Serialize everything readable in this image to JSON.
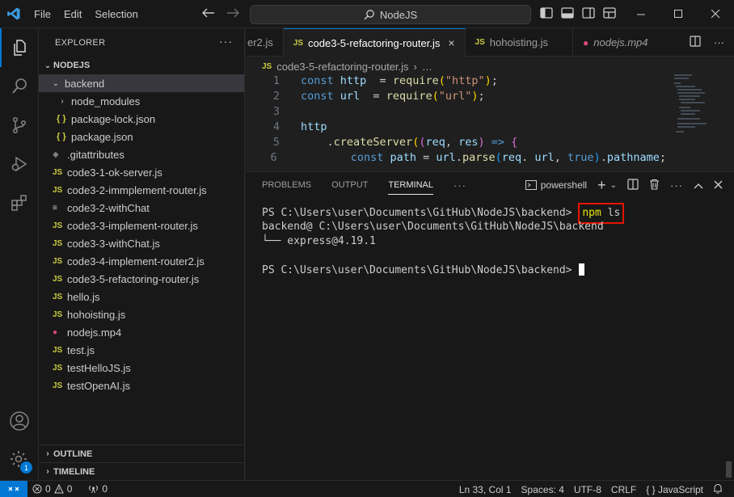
{
  "titlebar": {
    "menu": [
      "File",
      "Edit",
      "Selection"
    ],
    "search_text": "NodeJS"
  },
  "activity_bar": {
    "icons": [
      "explorer-icon",
      "search-icon",
      "source-control-icon",
      "run-debug-icon",
      "extensions-icon",
      "account-icon",
      "manage-icon"
    ],
    "manage_badge": "1",
    "accent": "#0078d4"
  },
  "explorer": {
    "title": "EXPLORER",
    "root": "NODEJS",
    "items": [
      {
        "label": "backend",
        "type": "folder-open",
        "depth": 1
      },
      {
        "label": "node_modules",
        "type": "folder",
        "depth": 2
      },
      {
        "label": "package-lock.json",
        "type": "json",
        "depth": 2
      },
      {
        "label": "package.json",
        "type": "json",
        "depth": 2
      },
      {
        "label": ".gitattributes",
        "type": "git",
        "depth": 1
      },
      {
        "label": "code3-1-ok-server.js",
        "type": "js",
        "depth": 1
      },
      {
        "label": "code3-2-immplement-router.js",
        "type": "js",
        "depth": 1
      },
      {
        "label": "code3-2-withChat",
        "type": "md",
        "depth": 1
      },
      {
        "label": "code3-3-implement-router.js",
        "type": "js",
        "depth": 1
      },
      {
        "label": "code3-3-withChat.js",
        "type": "js",
        "depth": 1
      },
      {
        "label": "code3-4-implement-router2.js",
        "type": "js",
        "depth": 1
      },
      {
        "label": "code3-5-refactoring-router.js",
        "type": "js",
        "depth": 1
      },
      {
        "label": "hello.js",
        "type": "js",
        "depth": 1
      },
      {
        "label": "hohoisting.js",
        "type": "js",
        "depth": 1
      },
      {
        "label": "nodejs.mp4",
        "type": "mp4",
        "depth": 1
      },
      {
        "label": "test.js",
        "type": "js",
        "depth": 1
      },
      {
        "label": "testHelloJS.js",
        "type": "js",
        "depth": 1
      },
      {
        "label": "testOpenAI.js",
        "type": "js",
        "depth": 1
      }
    ],
    "outline": "OUTLINE",
    "timeline": "TIMELINE"
  },
  "tabs": [
    {
      "label": "er2.js",
      "icon": "JS",
      "active": false
    },
    {
      "label": "code3-5-refactoring-router.js",
      "icon": "JS",
      "active": true
    },
    {
      "label": "hohoisting.js",
      "icon": "JS",
      "active": false
    },
    {
      "label": "nodejs.mp4",
      "icon": "▶",
      "active": false
    }
  ],
  "breadcrumb": {
    "icon": "JS",
    "file": "code3-5-refactoring-router.js",
    "more": "…"
  },
  "code_lines": [
    {
      "n": "1",
      "tokens": [
        [
          "k",
          "const "
        ],
        [
          "v",
          "http"
        ],
        [
          "",
          "  = "
        ],
        [
          "f",
          "require"
        ],
        [
          "p",
          "("
        ],
        [
          "s",
          "\"http\""
        ],
        [
          "p",
          ")"
        ],
        [
          "",
          ";"
        ]
      ]
    },
    {
      "n": "2",
      "tokens": [
        [
          "k",
          "const "
        ],
        [
          "v",
          "url"
        ],
        [
          "",
          ""
        ],
        [
          "",
          ""
        ],
        [
          "",
          ""
        ],
        [
          "",
          "  = "
        ],
        [
          "f",
          "require"
        ],
        [
          "p",
          "("
        ],
        [
          "s",
          "\"url\""
        ],
        [
          "p",
          ")"
        ],
        [
          "",
          ";"
        ]
      ]
    },
    {
      "n": "3",
      "tokens": []
    },
    {
      "n": "4",
      "tokens": [
        [
          "v",
          "http"
        ]
      ]
    },
    {
      "n": "5",
      "tokens": [
        [
          "",
          "    ."
        ],
        [
          "f",
          "createServer"
        ],
        [
          "p",
          "("
        ],
        [
          "p2",
          "("
        ],
        [
          "v",
          "req"
        ],
        [
          "",
          ", "
        ],
        [
          "v",
          "res"
        ],
        [
          "p2",
          ")"
        ],
        [
          "k",
          " => "
        ],
        [
          "p2",
          "{"
        ]
      ]
    },
    {
      "n": "6",
      "tokens": [
        [
          "",
          "        "
        ],
        [
          "k",
          "const "
        ],
        [
          "v",
          "path"
        ],
        [
          "",
          " = "
        ],
        [
          "v",
          "url"
        ],
        [
          "",
          "."
        ],
        [
          "f",
          "parse"
        ],
        [
          "p3",
          "("
        ],
        [
          "v",
          "req"
        ],
        [
          "",
          ". "
        ],
        [
          "v",
          "url"
        ],
        [
          "",
          ", "
        ],
        [
          "k",
          "true"
        ],
        [
          "p3",
          ")"
        ],
        [
          "",
          "."
        ],
        [
          "v",
          "pathname"
        ],
        [
          "",
          ";"
        ]
      ]
    }
  ],
  "panel": {
    "tabs": [
      "PROBLEMS",
      "OUTPUT",
      "TERMINAL"
    ],
    "active_tab": "TERMINAL",
    "more": "···",
    "shell": "powershell",
    "terminal": {
      "prompt1": "PS C:\\Users\\user\\Documents\\GitHub\\NodeJS\\backend> ",
      "command_npm": "npm",
      "command_rest": " ls",
      "out1": "backend@ C:\\Users\\user\\Documents\\GitHub\\NodeJS\\backend",
      "out2": "└── express@4.19.1",
      "prompt2": "PS C:\\Users\\user\\Documents\\GitHub\\NodeJS\\backend>"
    },
    "highlight_color": "#e51400"
  },
  "statusbar": {
    "errors": "0",
    "warnings": "0",
    "ports": "0",
    "position": "Ln 33, Col 1",
    "spaces": "Spaces: 4",
    "encoding": "UTF-8",
    "eol": "CRLF",
    "language": "JavaScript",
    "language_braces": "{ }"
  }
}
